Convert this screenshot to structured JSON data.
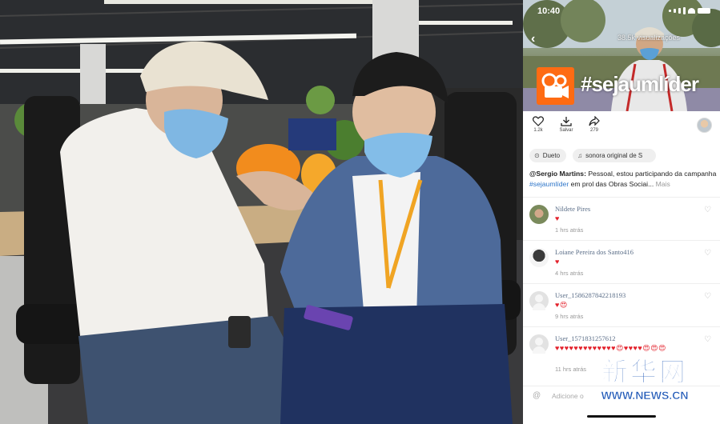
{
  "status": {
    "time": "10:40"
  },
  "video": {
    "views": "38.5k visualizações",
    "hashtag": "#sejaumlíder",
    "logo_icon": "video-camera-icon",
    "brand_color": "#fe6b13"
  },
  "actions": {
    "like_count": "1.2k",
    "save_label": "Salvar",
    "share_count": "279"
  },
  "chips": {
    "duet_label": "Dueto",
    "sound_label": "sonora original de S"
  },
  "caption": {
    "user": "@Sergio Martins:",
    "text_before": " Pessoal, estou participando da campanha ",
    "tag": "#sejaumlíder",
    "text_after": " em prol das Obras Sociai...",
    "more": "Mais"
  },
  "comments": [
    {
      "name": "Nildete Pires",
      "emoji": "♥",
      "time": "1 hrs atrás"
    },
    {
      "name": "Loiane Pereira dos Santo416",
      "emoji": "♥",
      "time": "4 hrs atrás"
    },
    {
      "name": "User_1586287842218193",
      "emoji": "♥😍",
      "time": "9 hrs atrás"
    },
    {
      "name": "User_1571831257612",
      "emoji": "♥♥♥♥♥♥♥♥♥♥♥♥♥😍♥♥♥♥😍😍😍",
      "time": "11 hrs atrás"
    }
  ],
  "add_comment": {
    "placeholder": "Adicione o"
  },
  "watermark": {
    "cn": "新华网",
    "en": "WWW.NEWS.CN"
  }
}
